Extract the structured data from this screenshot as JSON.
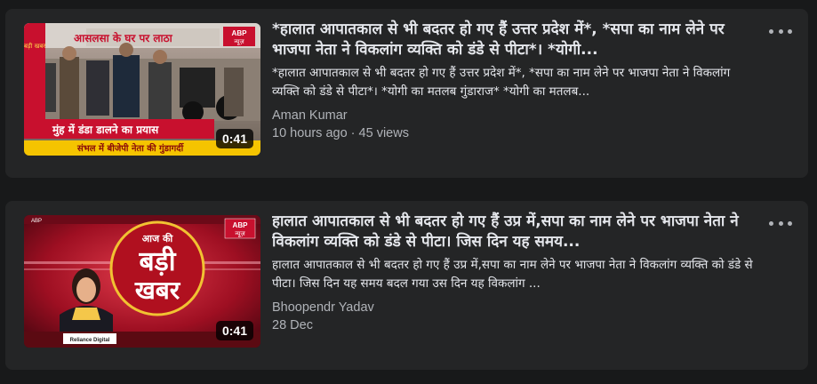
{
  "videos": [
    {
      "title": "*हालात आपातकाल से भी बदतर हो गए हैं उत्तर प्रदेश में*, *सपा का नाम लेने पर भाजपा नेता ने विकलांग व्यक्ति को डंडे से पीटा*। *योगी...",
      "description": "*हालात आपातकाल से भी बदतर हो गए हैं उत्तर प्रदेश में*, *सपा का नाम लेने पर भाजपा नेता ने विकलांग व्यक्ति को डंडे से पीटा*। *योगी का मतलब गुंडाराज* *योगी का मतलब...",
      "author": "Aman Kumar",
      "meta": "10 hours ago · 45 views",
      "duration": "0:41",
      "thumb_banner_text": "मुंह में डंडा डालने का प्रयास",
      "thumb_ticker_text": "संभल में बीजेपी नेता की गुंडागर्दी",
      "thumb_top_text": "आसलसा के घर पर लाठा",
      "thumb_logo_text": "ABP",
      "thumb_logo_sub": "न्यूज़",
      "thumb_side_tag_text": "बड़ी खबर",
      "more_icon": "more-horizontal-icon"
    },
    {
      "title": "हालात आपातकाल से भी बदतर हो गए हैं उप्र में,सपा का नाम लेने पर भाजपा नेता ने विकलांग व्यक्ति को डंडे से पीटा। जिस दिन यह समय...",
      "description": "हालात आपातकाल से भी बदतर हो गए हैं उप्र में,सपा का नाम लेने पर भाजपा नेता ने विकलांग व्यक्ति को डंडे से पीटा। जिस दिन यह समय बदल गया उस दिन यह विकलांग ...",
      "author": "Bhoopendr Yadav",
      "meta": "28 Dec",
      "duration": "0:41",
      "thumb_title_line1": "आज की",
      "thumb_title_line2": "बड़ी",
      "thumb_title_line3": "खबर",
      "thumb_logo_text": "ABP",
      "thumb_logo_sub": "न्यूज़",
      "thumb_ticker_text": "ABP",
      "thumb_brand_text": "Reliance Digital",
      "more_icon": "more-horizontal-icon"
    }
  ],
  "colors": {
    "page_bg": "#18191a",
    "card_bg": "#242526",
    "text_primary": "#e4e6eb",
    "text_secondary": "#b0b3b8"
  }
}
